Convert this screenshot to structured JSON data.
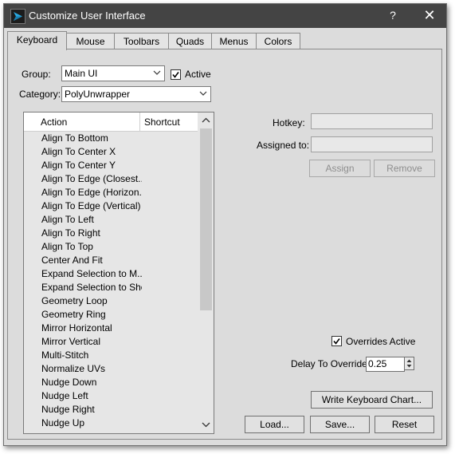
{
  "window": {
    "title": "Customize User Interface",
    "help_label": "?",
    "close_label": "✕"
  },
  "tabs": [
    {
      "label": "Keyboard",
      "active": true
    },
    {
      "label": "Mouse"
    },
    {
      "label": "Toolbars"
    },
    {
      "label": "Quads"
    },
    {
      "label": "Menus"
    },
    {
      "label": "Colors"
    }
  ],
  "group": {
    "label": "Group:",
    "value": "Main UI"
  },
  "active_checkbox": {
    "label": "Active",
    "checked": true
  },
  "category": {
    "label": "Category:",
    "value": "PolyUnwrapper"
  },
  "list": {
    "columns": [
      "Action",
      "Shortcut"
    ],
    "rows": [
      "Align To Bottom",
      "Align To Center X",
      "Align To Center Y",
      "Align To Edge (Closest...",
      "Align To Edge (Horizon...",
      "Align To Edge (Vertical)",
      "Align To Left",
      "Align To Right",
      "Align To Top",
      "Center And Fit",
      "Expand Selection to M...",
      "Expand Selection to Shell",
      "Geometry Loop",
      "Geometry Ring",
      "Mirror Horizontal",
      "Mirror Vertical",
      "Multi-Stitch",
      "Normalize UVs",
      "Nudge Down",
      "Nudge Left",
      "Nudge Right",
      "Nudge Up"
    ]
  },
  "hotkey": {
    "label": "Hotkey:",
    "value": ""
  },
  "assigned_to": {
    "label": "Assigned to:",
    "value": ""
  },
  "buttons": {
    "assign": "Assign",
    "remove": "Remove",
    "write_chart": "Write Keyboard Chart...",
    "load": "Load...",
    "save": "Save...",
    "reset": "Reset"
  },
  "overrides": {
    "label": "Overrides Active",
    "checked": true
  },
  "delay": {
    "label": "Delay To Override:",
    "value": "0.25"
  },
  "colors": {
    "titlebar": "#444444",
    "panel": "#dcdcdc",
    "brand_icon": "#29a9e1"
  }
}
